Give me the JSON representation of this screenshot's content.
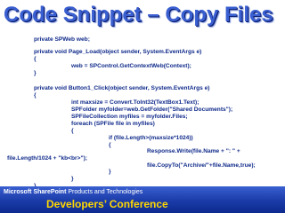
{
  "slide": {
    "title": "Code Snippet – Copy Files"
  },
  "code": {
    "lines": [
      "private SPWeb web;",
      "private void Page_Load(object sender, System.EventArgs e)",
      "{",
      "web = SPControl.GetContextWeb(Context);",
      "}",
      "private void Button1_Click(object sender, System.EventArgs e)",
      "{",
      "int maxsize = Convert.ToInt32(TextBox1.Text);",
      "SPFolder myfolder=web.GetFolder(\"Shared Documents\");",
      "SPFileCollection myfiles = myfolder.Files;",
      "foreach (SPFile file in myfiles)",
      "{",
      "if (file.Length>(maxsize*1024))",
      "{",
      "Response.Write(file.Name + \": \" +",
      "file.Length/1024 + \"kb<br>\");",
      "file.CopyTo(\"Archive/\"+file.Name,true);",
      "}",
      "}",
      "}"
    ]
  },
  "footer": {
    "brand_line_part1": "Microsoft",
    "brand_line_part2": "SharePoint",
    "brand_line_part3": " Products and Technologies",
    "conference": "Developers’ Conference"
  }
}
